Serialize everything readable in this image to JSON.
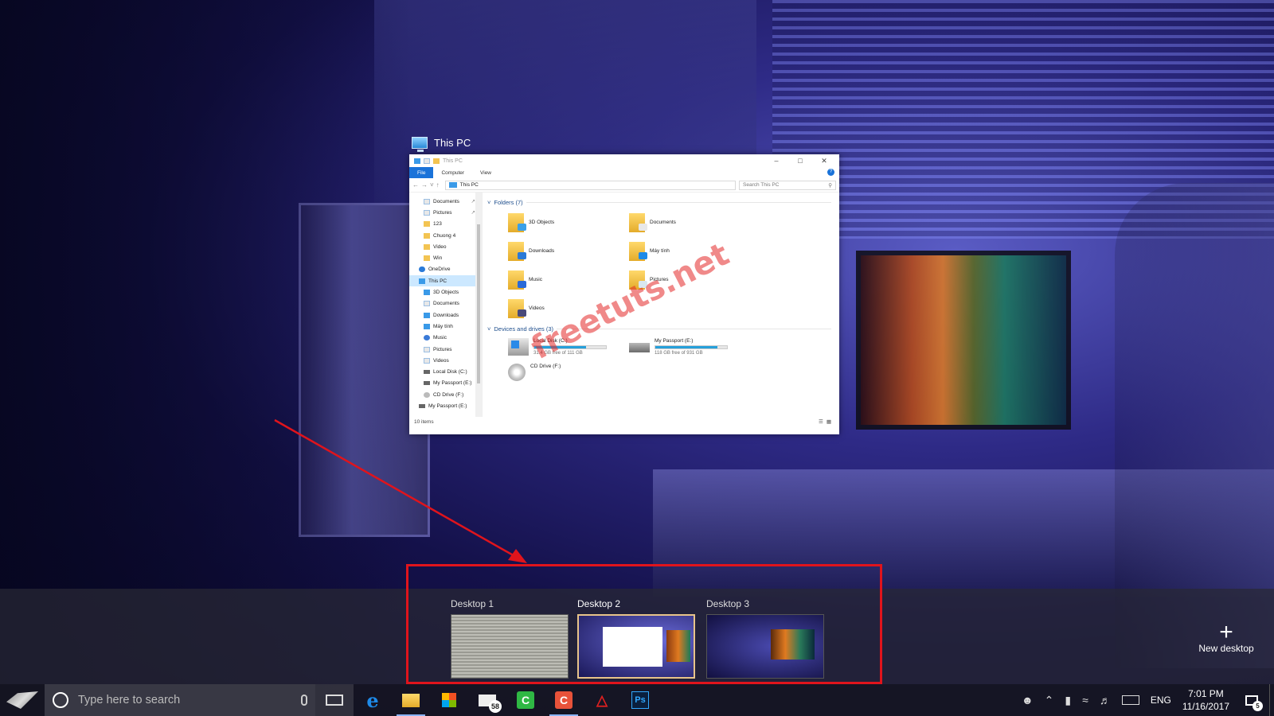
{
  "window": {
    "caption": "This PC",
    "title": "This PC",
    "ribbon_tabs": [
      "File",
      "Computer",
      "View"
    ],
    "address": "This PC",
    "search_placeholder": "Search This PC",
    "nav_items": [
      {
        "label": "Documents",
        "icon": "doc",
        "pinned": true
      },
      {
        "label": "Pictures",
        "icon": "doc",
        "pinned": true
      },
      {
        "label": "123",
        "icon": "folder"
      },
      {
        "label": "Chuong 4",
        "icon": "folder"
      },
      {
        "label": "Video",
        "icon": "folder"
      },
      {
        "label": "Win",
        "icon": "folder"
      },
      {
        "label": "OneDrive",
        "icon": "cloud",
        "top": true
      },
      {
        "label": "This PC",
        "icon": "blue",
        "top": true,
        "selected": true
      },
      {
        "label": "3D Objects",
        "icon": "blue"
      },
      {
        "label": "Documents",
        "icon": "doc"
      },
      {
        "label": "Downloads",
        "icon": "blue"
      },
      {
        "label": "Máy tính",
        "icon": "blue"
      },
      {
        "label": "Music",
        "icon": "music"
      },
      {
        "label": "Pictures",
        "icon": "doc"
      },
      {
        "label": "Videos",
        "icon": "doc"
      },
      {
        "label": "Local Disk (C:)",
        "icon": "drive"
      },
      {
        "label": "My Passport (E:)",
        "icon": "drive"
      },
      {
        "label": "CD Drive (F:)",
        "icon": "cd"
      },
      {
        "label": "My Passport (E:)",
        "icon": "drive",
        "top": true
      }
    ],
    "folders_header": "Folders (7)",
    "folders": [
      {
        "label": "3D Objects",
        "badge": "#3aa0e8"
      },
      {
        "label": "Documents",
        "badge": "#e8e8e8"
      },
      {
        "label": "Downloads",
        "badge": "#2a7ad8"
      },
      {
        "label": "Máy tính",
        "badge": "#1e8ae8"
      },
      {
        "label": "Music",
        "badge": "#2a6ad8"
      },
      {
        "label": "Pictures",
        "badge": "#d9e8f0"
      },
      {
        "label": "Videos",
        "badge": "#4a4a7a"
      }
    ],
    "devices_header": "Devices and drives (3)",
    "drives": [
      {
        "label": "Local Disk (C:)",
        "free": "31.4 GB free of 111 GB",
        "used_fraction": 0.72,
        "icon": "win"
      },
      {
        "label": "My Passport (E:)",
        "free": "118 GB free of 931 GB",
        "used_fraction": 0.87,
        "icon": "ext"
      },
      {
        "label": "CD Drive (F:)",
        "free": "",
        "icon": "cd"
      }
    ],
    "status": "10 items"
  },
  "watermark": "freetuts.net",
  "desktops": [
    {
      "label": "Desktop 1",
      "active": false
    },
    {
      "label": "Desktop 2",
      "active": true
    },
    {
      "label": "Desktop 3",
      "active": false
    }
  ],
  "new_desktop_label": "New desktop",
  "taskbar": {
    "search_placeholder": "Type here to search",
    "mail_badge": "58",
    "photoshop_label": "Ps",
    "language": "ENG",
    "time": "7:01 PM",
    "date": "11/16/2017",
    "notification_count": "5"
  },
  "colors": {
    "highlight": "#e0141c",
    "accent": "#1a73d9"
  }
}
